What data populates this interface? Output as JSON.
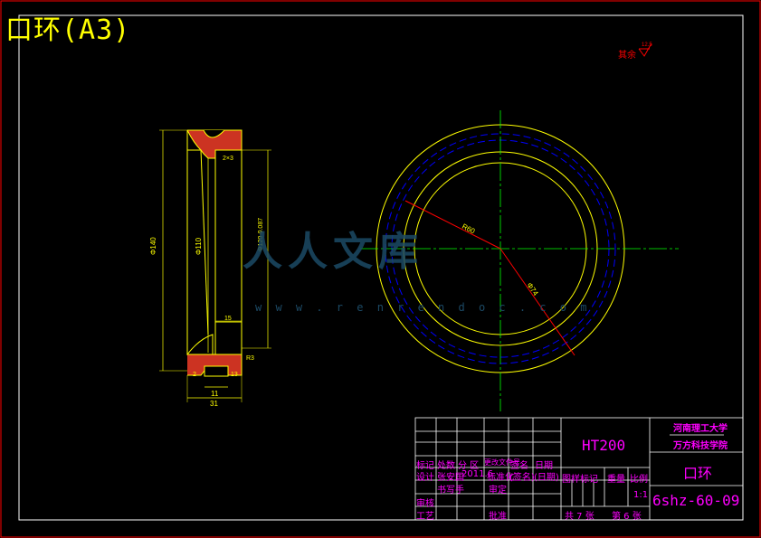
{
  "drawing_title": "口环(A3)",
  "roughness_note": "其余",
  "roughness_value": "12.5",
  "watermark": {
    "text": "人人文库",
    "url": "w w w . r e n r e n d o c . c o m"
  },
  "section_view": {
    "dims": {
      "outer_dia": "Φ140",
      "bore_dia": "Φ110",
      "inner_dia": "Φ120-0.087",
      "groove_width": "11",
      "total_width": "31",
      "flange_width": "15",
      "chamfer_1": "2",
      "chamfer_2": "13",
      "chamfer_3": "2×3",
      "chamfer_4": "R3"
    }
  },
  "circle_view": {
    "dims": {
      "radius_label": "R60",
      "dia_label": "Φ74"
    }
  },
  "title_block": {
    "material": "HT200",
    "school_line1": "河南理工大学",
    "school_line2": "万方科技学院",
    "part_name": "口环",
    "drawing_no": "6shz-60-09",
    "scale_label": "比例",
    "scale": "1:1",
    "weight_label": "重量",
    "stage_label": "图样标记",
    "sheets_total": "共 7 张",
    "sheet_no": "第 6 张",
    "row_labels": {
      "mark": "标记",
      "count": "处数",
      "zone": "分 区",
      "change_doc": "更改文件号",
      "sign": "签名",
      "date": "日期",
      "design": "设计",
      "design_by": "张安国",
      "date_val": "2011.6",
      "standard": "标准化",
      "std_sign": "(签名)",
      "std_date": "(日期)",
      "draft": "书写手",
      "review": "审定",
      "check": "审核",
      "process": "工艺",
      "approve": "批准"
    }
  }
}
